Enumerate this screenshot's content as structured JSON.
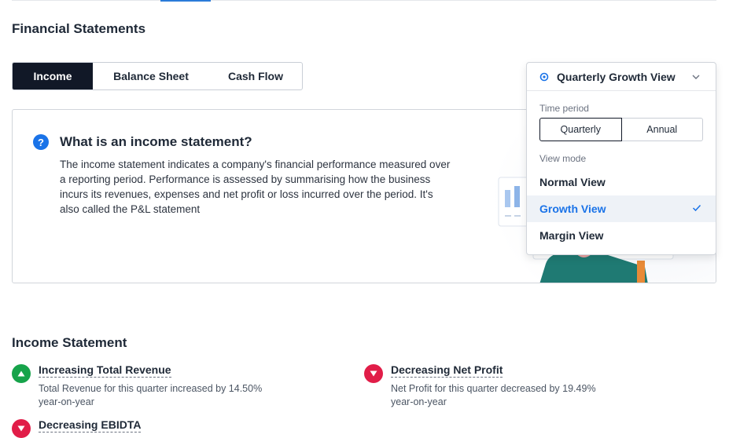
{
  "page": {
    "title": "Financial Statements"
  },
  "tabs": [
    {
      "label": "Income",
      "active": true
    },
    {
      "label": "Balance Sheet",
      "active": false
    },
    {
      "label": "Cash Flow",
      "active": false
    }
  ],
  "info": {
    "title": "What is an income statement?",
    "body": "The income statement indicates a company's financial performance measured over a reporting period. Performance is assessed by summarising how the business incurs its revenues, expenses and net profit or loss incurred over the period. It's also called the P&L statement",
    "help_icon": "question-icon"
  },
  "view_dropdown": {
    "selected_label": "Quarterly Growth View",
    "time_period_label": "Time period",
    "periods": [
      "Quarterly",
      "Annual"
    ],
    "selected_period": "Quarterly",
    "view_mode_label": "View mode",
    "modes": [
      "Normal View",
      "Growth View",
      "Margin View"
    ],
    "selected_mode": "Growth View",
    "accent_color": "#1a73e8"
  },
  "income_statement": {
    "title": "Income Statement",
    "metrics": [
      {
        "title": "Increasing Total Revenue",
        "description": "Total Revenue for this quarter increased by 14.50% year-on-year",
        "trend": "up",
        "color": "#16a34a"
      },
      {
        "title": "Decreasing Net Profit",
        "description": "Net Profit for this quarter decreased by 19.49% year-on-year",
        "trend": "down",
        "color": "#e11d48"
      },
      {
        "title": "Decreasing EBIDTA",
        "description": "",
        "trend": "down",
        "color": "#e11d48"
      }
    ]
  }
}
